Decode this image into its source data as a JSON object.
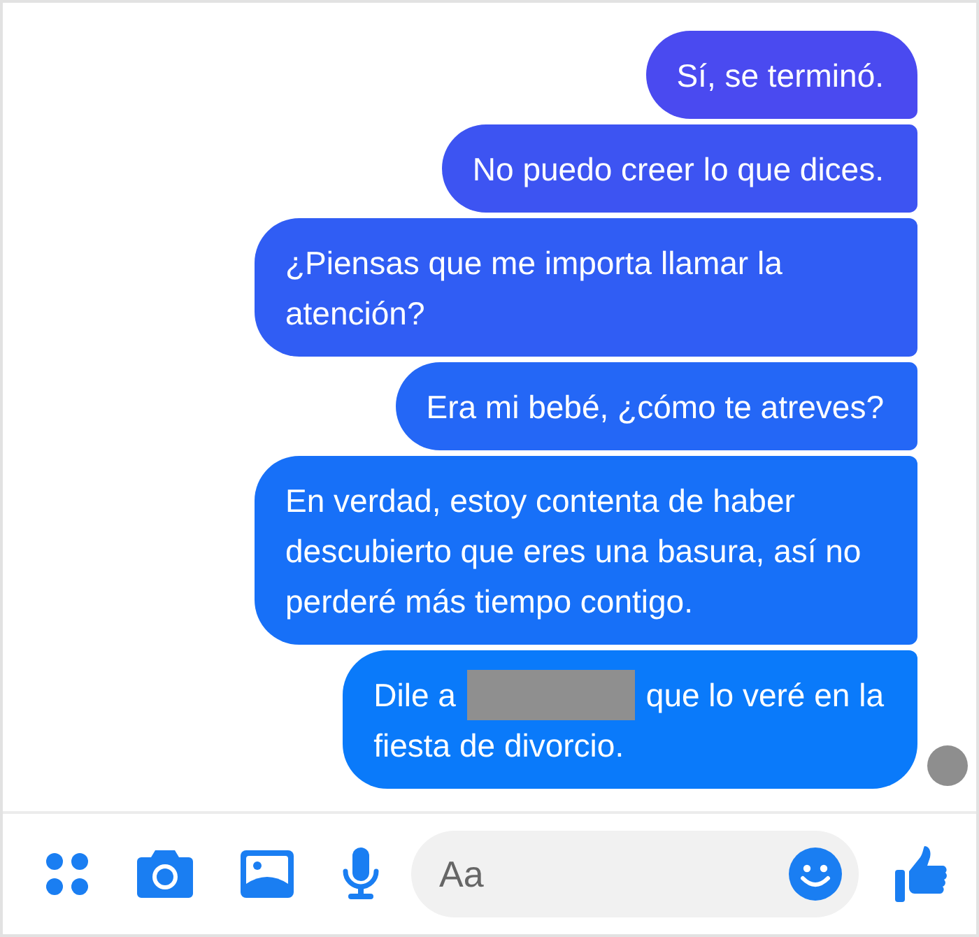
{
  "messages": [
    {
      "parts": [
        {
          "kind": "text",
          "text": "Sí, se terminó."
        }
      ]
    },
    {
      "parts": [
        {
          "kind": "text",
          "text": "No puedo creer lo que dices."
        }
      ]
    },
    {
      "parts": [
        {
          "kind": "text",
          "text": "¿Piensas que me importa llamar la atención?"
        }
      ]
    },
    {
      "parts": [
        {
          "kind": "text",
          "text": "Era mi bebé, ¿cómo te atreves?"
        }
      ]
    },
    {
      "parts": [
        {
          "kind": "text",
          "text": "En verdad, estoy contenta de haber descubierto que eres una basura, así no perderé más tiempo contigo."
        }
      ]
    },
    {
      "parts": [
        {
          "kind": "text",
          "text": "Dile a"
        },
        {
          "kind": "redacted"
        },
        {
          "kind": "text",
          "text": "que lo veré en la"
        },
        {
          "kind": "break"
        },
        {
          "kind": "text",
          "text": "fiesta de divorcio."
        }
      ]
    }
  ],
  "seen": true,
  "composer": {
    "placeholder": "Aa"
  }
}
